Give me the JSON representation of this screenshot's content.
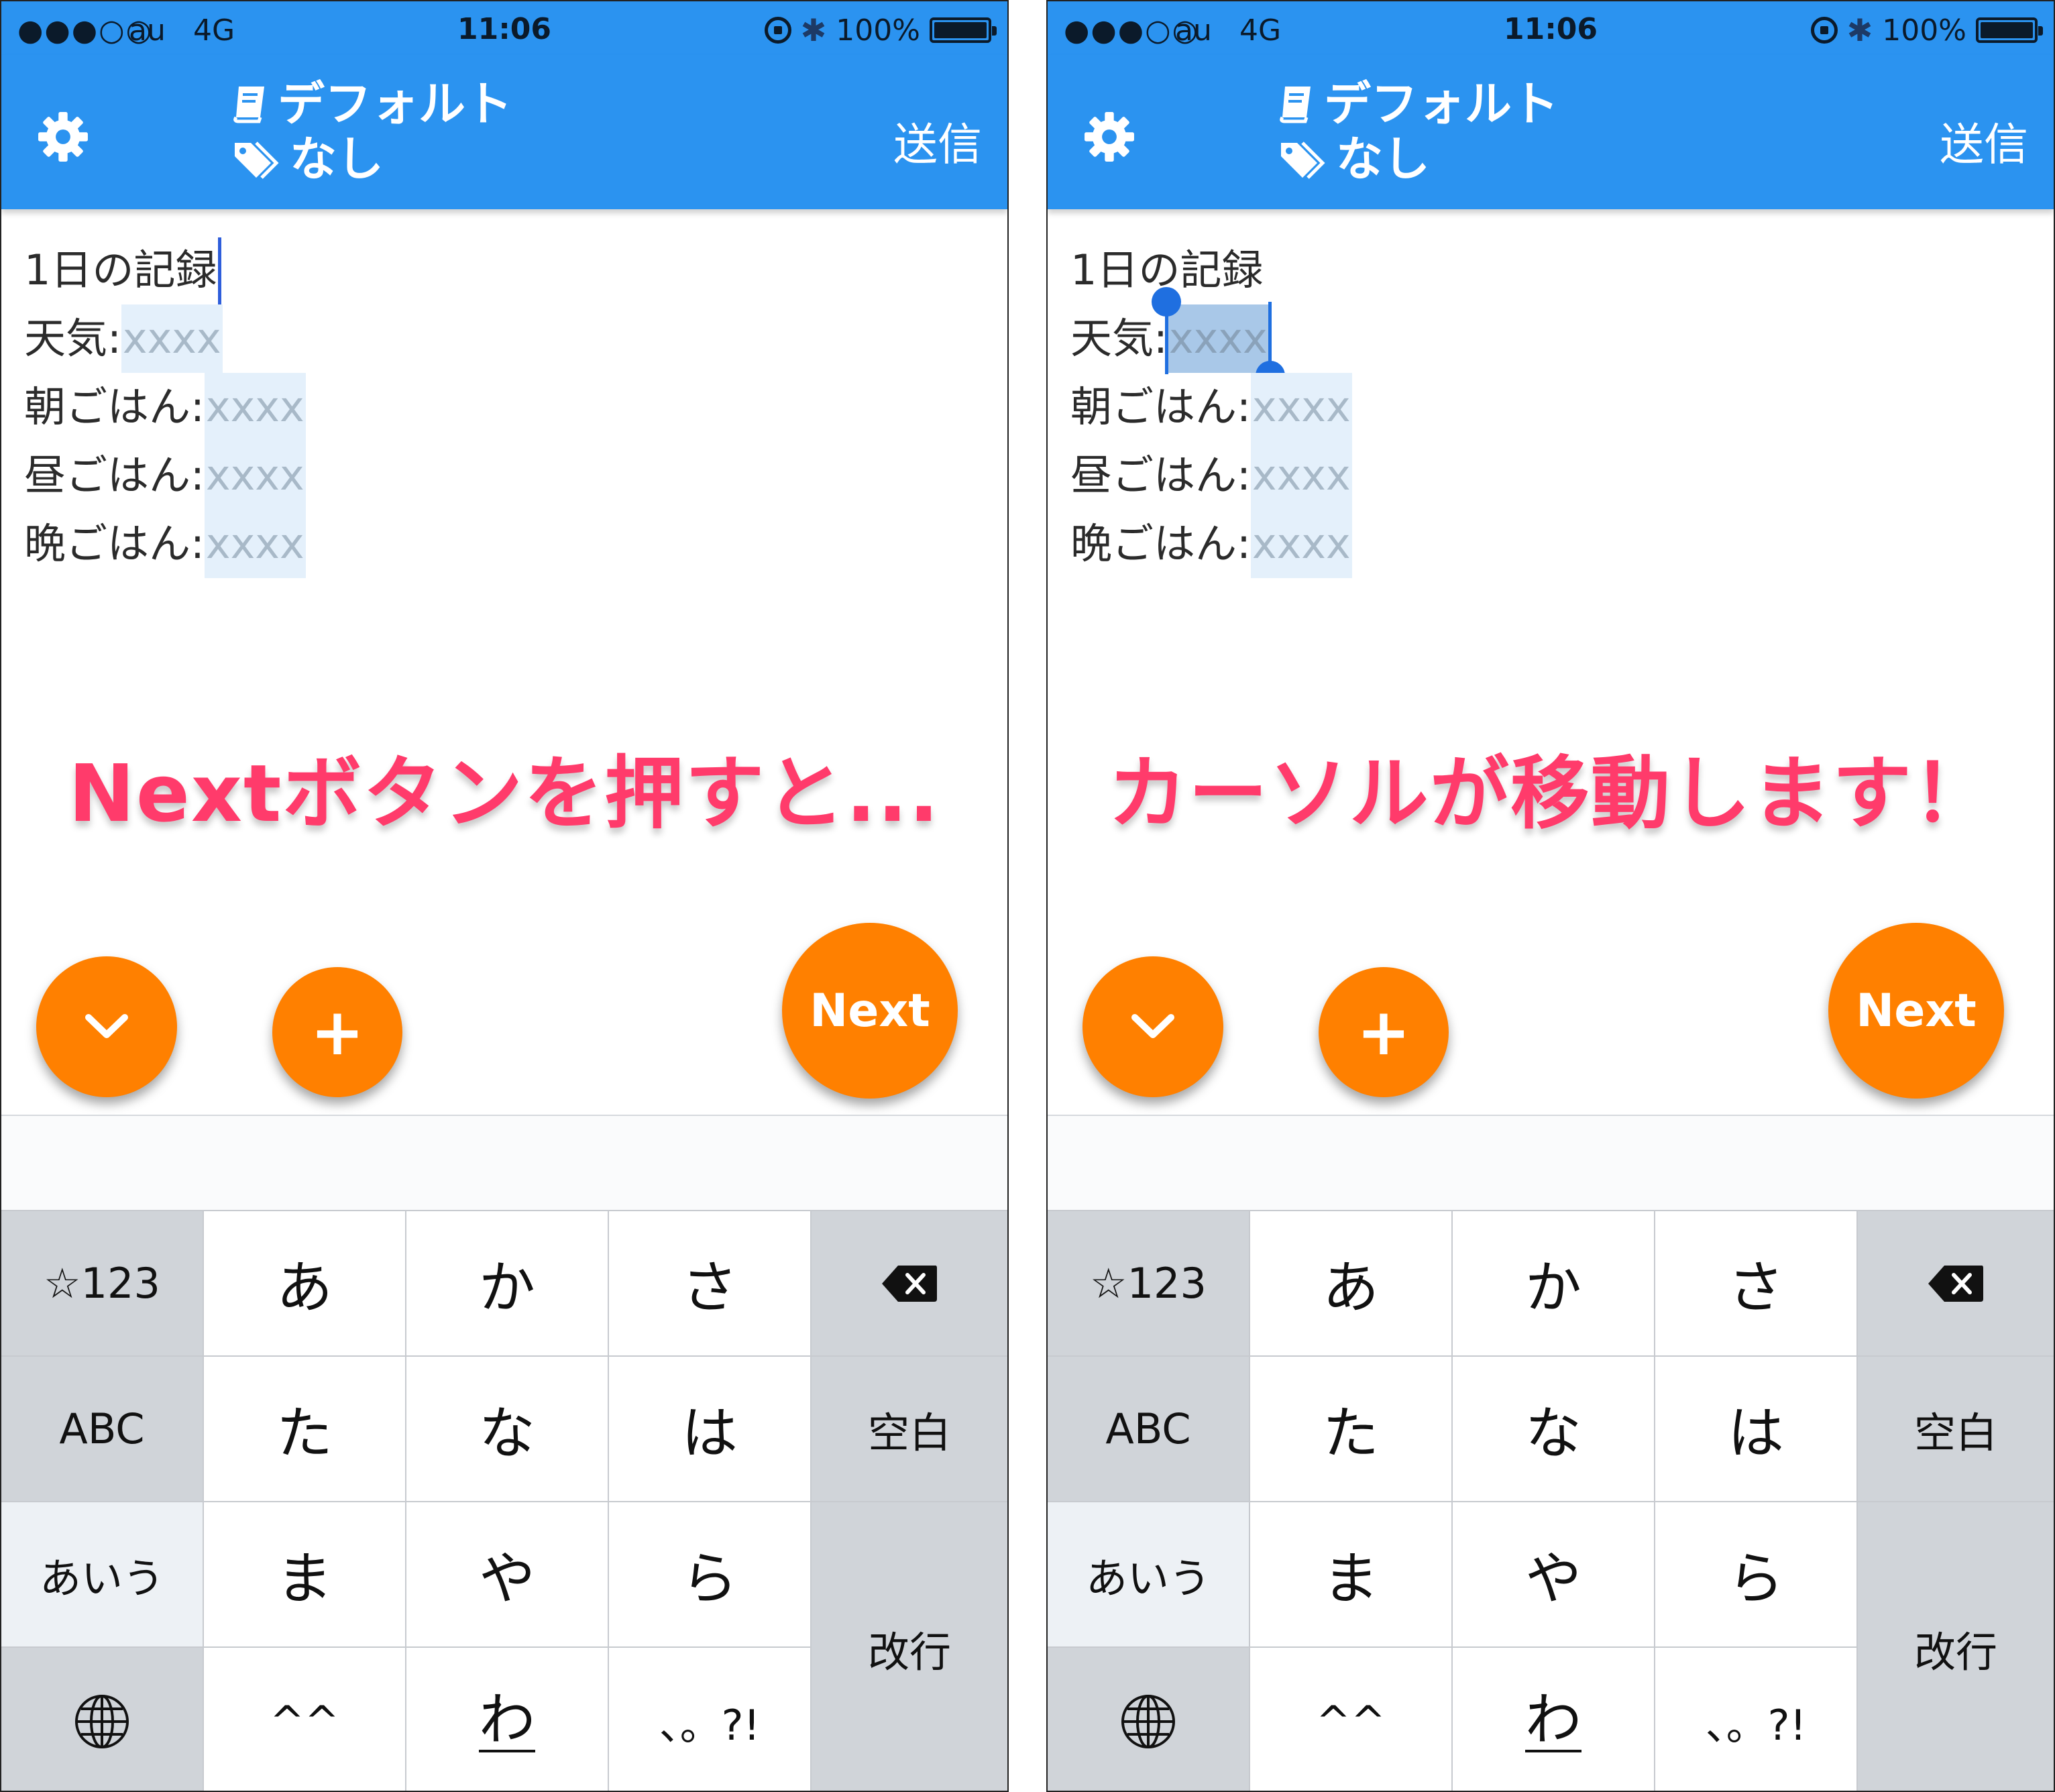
{
  "colors": {
    "accent": "#2b93f0",
    "fab": "#ff8000",
    "caption": "#ff3b6b",
    "placeholder_bg": "#e4f0fb",
    "cursor": "#2e5edb"
  },
  "left": {
    "status": {
      "signal": "●●●○○",
      "carrier": "au",
      "network": "4G",
      "time": "11:06",
      "battery": "100%"
    },
    "nav": {
      "notebook": "デフォルト",
      "tag": "なし",
      "send": "送信"
    },
    "editor": {
      "line1": "1日の記録",
      "line2_label": "天気:",
      "line2_ph": "xxxx",
      "line3_label": "朝ごはん:",
      "line3_ph": "xxxx",
      "line4_label": "昼ごはん:",
      "line4_ph": "xxxx",
      "line5_label": "晩ごはん:",
      "line5_ph": "xxxx"
    },
    "caption": "Nextボタンを押すと...",
    "fab": {
      "next": "Next",
      "plus": "+"
    }
  },
  "right": {
    "status": {
      "signal": "●●●○○",
      "carrier": "au",
      "network": "4G",
      "time": "11:06",
      "battery": "100%"
    },
    "nav": {
      "notebook": "デフォルト",
      "tag": "なし",
      "send": "送信"
    },
    "editor": {
      "line1": "1日の記録",
      "line2_label": "天気:",
      "line2_ph": "xxxx",
      "line3_label": "朝ごはん:",
      "line3_ph": "xxxx",
      "line4_label": "昼ごはん:",
      "line4_ph": "xxxx",
      "line5_label": "晩ごはん:",
      "line5_ph": "xxxx"
    },
    "caption": "カーソルが移動します！",
    "fab": {
      "next": "Next",
      "plus": "+"
    }
  },
  "keyboard": {
    "row1": [
      "☆123",
      "あ",
      "か",
      "さ"
    ],
    "row2": [
      "ABC",
      "た",
      "な",
      "は",
      "空白"
    ],
    "row3": [
      "あいう",
      "ま",
      "や",
      "ら"
    ],
    "row4": [
      "^^",
      "わ",
      "、。?!"
    ],
    "return": "改行",
    "icons": {
      "delete": "backspace-icon",
      "globe": "globe-icon"
    }
  }
}
